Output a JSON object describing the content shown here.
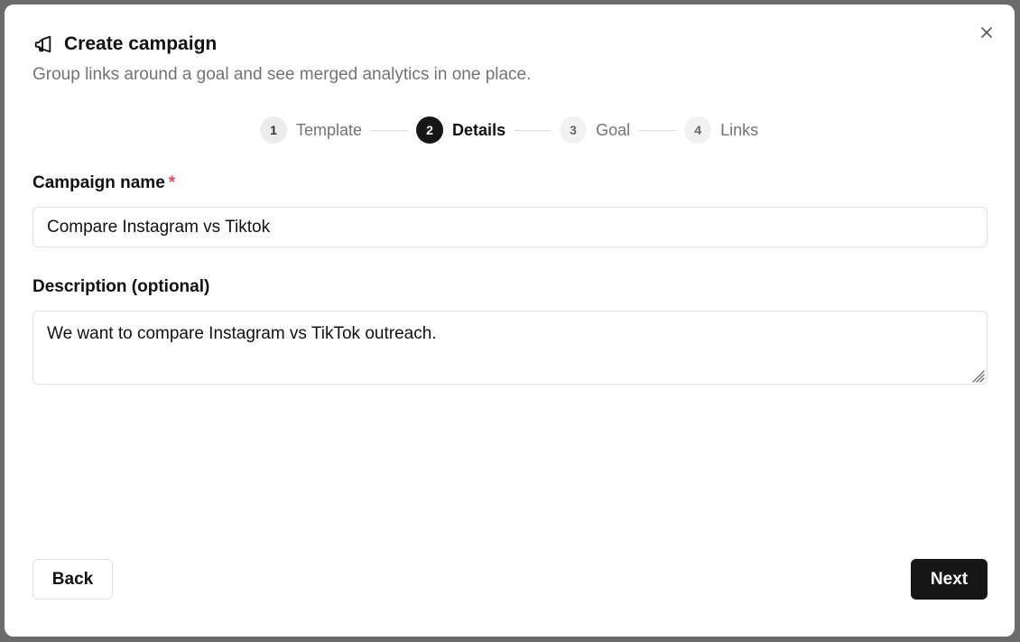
{
  "dialog": {
    "title": "Create campaign",
    "subtitle": "Group links around a goal and see merged analytics in one place.",
    "title_icon": "megaphone-icon",
    "close_icon": "close-icon"
  },
  "stepper": {
    "steps": [
      {
        "number": "1",
        "label": "Template",
        "state": "completed"
      },
      {
        "number": "2",
        "label": "Details",
        "state": "active"
      },
      {
        "number": "3",
        "label": "Goal",
        "state": "upcoming"
      },
      {
        "number": "4",
        "label": "Links",
        "state": "upcoming"
      }
    ]
  },
  "form": {
    "campaign_name": {
      "label": "Campaign name",
      "required_mark": "*",
      "value": "Compare Instagram vs Tiktok"
    },
    "description": {
      "label": "Description (optional)",
      "value": "We want to compare Instagram vs TikTok outreach."
    }
  },
  "footer": {
    "back_label": "Back",
    "next_label": "Next"
  },
  "colors": {
    "primary": "#171717",
    "required": "#e5484d",
    "muted_text": "#737373"
  }
}
